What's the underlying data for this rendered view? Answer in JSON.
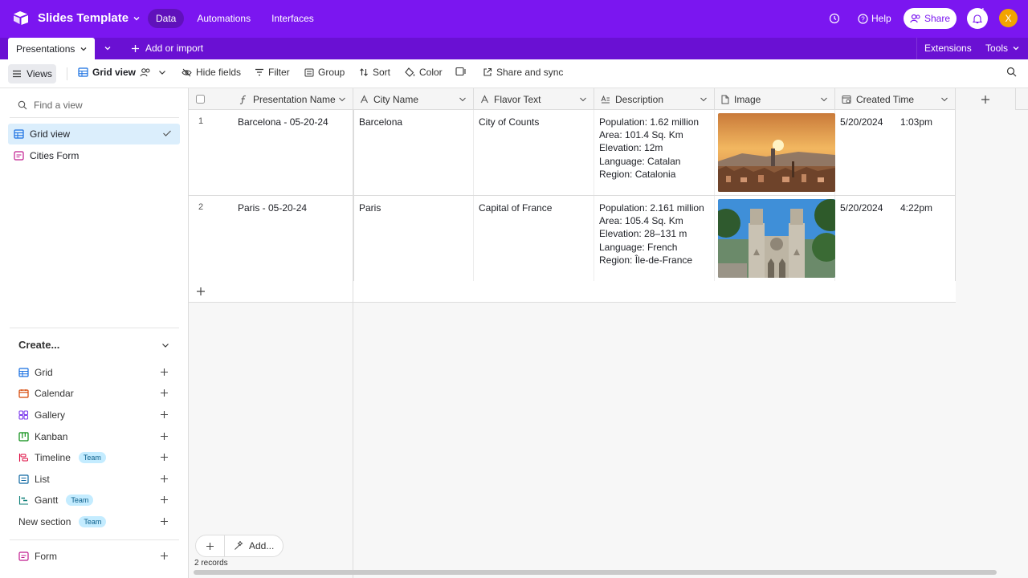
{
  "topbar": {
    "base_name": "Slides Template",
    "nav": [
      "Data",
      "Automations",
      "Interfaces"
    ],
    "help": "Help",
    "share": "Share",
    "notif_count": "4",
    "avatar_letter": "X"
  },
  "tablebar": {
    "table_name": "Presentations",
    "add_import": "Add or import",
    "extensions": "Extensions",
    "tools": "Tools"
  },
  "viewbar": {
    "views": "Views",
    "grid_view": "Grid view",
    "hide_fields": "Hide fields",
    "filter": "Filter",
    "group": "Group",
    "sort": "Sort",
    "color": "Color",
    "share_sync": "Share and sync"
  },
  "sidebar": {
    "find_placeholder": "Find a view",
    "views": [
      {
        "label": "Grid view"
      },
      {
        "label": "Cities Form"
      }
    ],
    "create_label": "Create...",
    "create_items": [
      {
        "label": "Grid",
        "badge": ""
      },
      {
        "label": "Calendar",
        "badge": ""
      },
      {
        "label": "Gallery",
        "badge": ""
      },
      {
        "label": "Kanban",
        "badge": ""
      },
      {
        "label": "Timeline",
        "badge": "Team"
      },
      {
        "label": "List",
        "badge": ""
      },
      {
        "label": "Gantt",
        "badge": "Team"
      }
    ],
    "new_section": "New section",
    "new_section_badge": "Team",
    "form": "Form"
  },
  "grid": {
    "columns": [
      "Presentation Name",
      "City Name",
      "Flavor Text",
      "Description",
      "Image",
      "Created Time"
    ],
    "rows": [
      {
        "num": "1",
        "presentation_name": "Barcelona - 05-20-24",
        "city": "Barcelona",
        "flavor": "City of Counts",
        "description": [
          "Population: 1.62 million",
          "Area: 101.4 Sq. Km",
          "Elevation: 12m",
          "Language: Catalan",
          "Region: Catalonia"
        ],
        "date": "5/20/2024",
        "time": "1:03pm"
      },
      {
        "num": "2",
        "presentation_name": "Paris - 05-20-24",
        "city": "Paris",
        "flavor": "Capital of France",
        "description": [
          "Population: 2.161 million",
          "Area: 105.4 Sq. Km",
          "Elevation: 28–131 m",
          "Language: French",
          "Region: Île-de-France"
        ],
        "date": "5/20/2024",
        "time": "4:22pm"
      }
    ],
    "add_label": "Add...",
    "records": "2 records"
  },
  "colors": {
    "brand": "#7b16f0",
    "brand_dark": "#6a10d3",
    "accent_blue": "#166ee1",
    "selected_view_bg": "#dbeefc"
  }
}
